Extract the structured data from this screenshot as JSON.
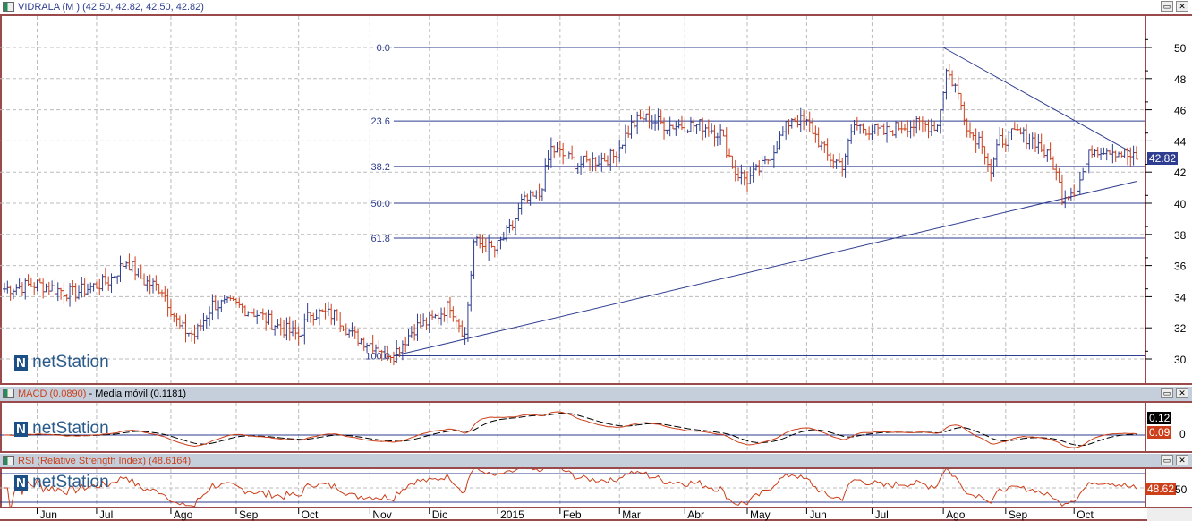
{
  "main": {
    "title": "VIDRALA (M ) (42.50, 42.82, 42.50, 42.82)",
    "last_price": "42.82",
    "watermark": "netStation",
    "y_ticks": [
      30,
      32,
      34,
      36,
      38,
      40,
      42,
      44,
      46,
      48,
      50
    ]
  },
  "macd": {
    "title": "MACD (0.0890)",
    "signal_title": "Media móvil (0.1181)",
    "macd_value": "0.09",
    "signal_value": "0.12",
    "zero_label": "0",
    "watermark": "netStation"
  },
  "rsi": {
    "title": "RSI (Relative Strength Index) (48.6164)",
    "value": "48.62",
    "mid_label": "50",
    "watermark": "netStation"
  },
  "window_buttons": {
    "restore": "▭",
    "close": "✕"
  },
  "colors": {
    "up": "#2e3d8f",
    "down": "#cc3f1a",
    "line": "#2e3d8f",
    "border": "#9a4a4a"
  },
  "chart_data": {
    "type": "ohlc",
    "price_anchors": [
      [
        0,
        34.5
      ],
      [
        11,
        34.8
      ],
      [
        23,
        34.2
      ],
      [
        35,
        35
      ],
      [
        41,
        36.3
      ],
      [
        47,
        35
      ],
      [
        53,
        34.5
      ],
      [
        59,
        32
      ],
      [
        64,
        31.5
      ],
      [
        70,
        33.5
      ],
      [
        77,
        33.5
      ],
      [
        84,
        33
      ],
      [
        93,
        32
      ],
      [
        99,
        31.5
      ],
      [
        103,
        33
      ],
      [
        112,
        32.8
      ],
      [
        117,
        31.5
      ],
      [
        123,
        31
      ],
      [
        131,
        30.3
      ],
      [
        138,
        32
      ],
      [
        144,
        32.5
      ],
      [
        150,
        33.5
      ],
      [
        155,
        31.5
      ],
      [
        158,
        37.5
      ],
      [
        165,
        37
      ],
      [
        171,
        38.5
      ],
      [
        174,
        40
      ],
      [
        180,
        40.5
      ],
      [
        184,
        43.5
      ],
      [
        193,
        42.5
      ],
      [
        205,
        43
      ],
      [
        211,
        45
      ],
      [
        215,
        45.5
      ],
      [
        223,
        45
      ],
      [
        235,
        45
      ],
      [
        241,
        44.5
      ],
      [
        246,
        42
      ],
      [
        250,
        41.5
      ],
      [
        256,
        42.5
      ],
      [
        262,
        44.5
      ],
      [
        265,
        45.5
      ],
      [
        271,
        45
      ],
      [
        277,
        43
      ],
      [
        282,
        42.5
      ],
      [
        286,
        45
      ],
      [
        296,
        44.5
      ],
      [
        302,
        45
      ],
      [
        314,
        45
      ],
      [
        317,
        48.5
      ],
      [
        320,
        47.5
      ],
      [
        325,
        44.5
      ],
      [
        329,
        44
      ],
      [
        332,
        42
      ],
      [
        335,
        44
      ],
      [
        341,
        44.5
      ],
      [
        347,
        44
      ],
      [
        353,
        42.5
      ],
      [
        356,
        40.5
      ],
      [
        361,
        41
      ],
      [
        366,
        43.5
      ],
      [
        372,
        43.5
      ],
      [
        381,
        42.82
      ]
    ],
    "months": [
      [
        "Jun",
        11
      ],
      [
        "Jul",
        31
      ],
      [
        "Ago",
        56
      ],
      [
        "Sep",
        78
      ],
      [
        "Oct",
        99
      ],
      [
        "Nov",
        123
      ],
      [
        "Dic",
        143
      ],
      [
        "2015",
        166
      ],
      [
        "Feb",
        187
      ],
      [
        "Mar",
        207
      ],
      [
        "Abr",
        229
      ],
      [
        "May",
        250
      ],
      [
        "Jun",
        270
      ],
      [
        "Jul",
        292
      ],
      [
        "Ago",
        316
      ],
      [
        "Sep",
        337
      ],
      [
        "Oct",
        360
      ]
    ],
    "fibonacci": {
      "levels": [
        [
          "0.0",
          50
        ],
        [
          "23.6",
          45.28
        ],
        [
          "38.2",
          42.36
        ],
        [
          "50.0",
          40.0
        ],
        [
          "61.8",
          37.76
        ],
        [
          "100.0",
          30.2
        ]
      ],
      "start_day": 131
    },
    "trendlines": [
      [
        [
          131,
          30.2
        ],
        [
          381,
          41.4
        ]
      ],
      [
        [
          316,
          50
        ],
        [
          379,
          43.3
        ]
      ]
    ],
    "ylim": [
      29,
      52
    ],
    "macd_ref": "zero",
    "rsi_bands": [
      30,
      50,
      70
    ]
  }
}
